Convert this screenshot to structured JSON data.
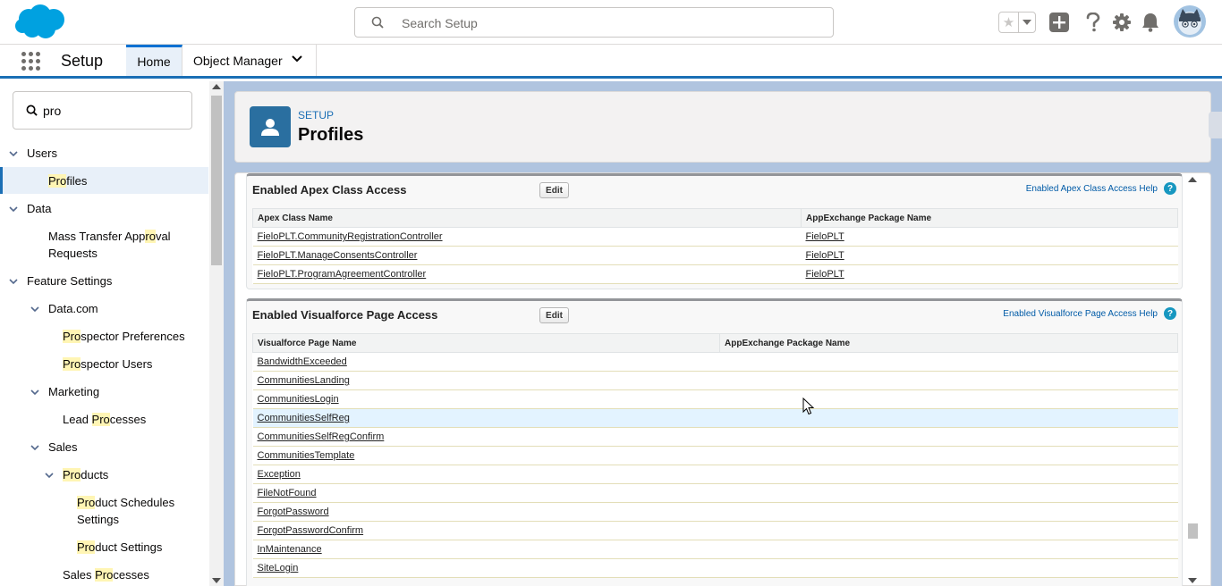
{
  "header": {
    "search_placeholder": "Search Setup",
    "icons": [
      "salesforce-cloud-logo",
      "favorites-star-icon",
      "add-icon",
      "help-icon",
      "setup-gear-icon",
      "notifications-bell-icon",
      "user-avatar"
    ],
    "brand_color": "#00a1e0"
  },
  "context": {
    "app_name": "Setup",
    "tabs": [
      {
        "label": "Home",
        "active": true
      },
      {
        "label": "Object Manager",
        "active": false
      }
    ]
  },
  "sidebar": {
    "quick_find_value": "pro",
    "highlight_color": "#fff5b4",
    "items": [
      {
        "pre": "",
        "hl": "",
        "post": "Users"
      },
      {
        "pre": "",
        "hl": "Pro",
        "post": "files"
      },
      {
        "pre": "",
        "hl": "",
        "post": "Data"
      },
      {
        "pre": "Mass Transfer App",
        "hl": "ro",
        "post": "val"
      },
      {
        "pre": "",
        "hl": "",
        "post": "Requests"
      },
      {
        "pre": "",
        "hl": "",
        "post": "Feature Settings"
      },
      {
        "pre": "",
        "hl": "",
        "post": "Data.com"
      },
      {
        "pre": "",
        "hl": "Pro",
        "post": "spector Preferences"
      },
      {
        "pre": "",
        "hl": "Pro",
        "post": "spector Users"
      },
      {
        "pre": "",
        "hl": "",
        "post": "Marketing"
      },
      {
        "pre": "Lead ",
        "hl": "Pro",
        "post": "cesses"
      },
      {
        "pre": "",
        "hl": "",
        "post": "Sales"
      },
      {
        "pre": "",
        "hl": "Pro",
        "post": "ducts"
      },
      {
        "pre": "",
        "hl": "Pro",
        "post": "duct Schedules"
      },
      {
        "pre": "",
        "hl": "",
        "post": "Settings"
      },
      {
        "pre": "",
        "hl": "Pro",
        "post": "duct Settings"
      },
      {
        "pre": "Sales ",
        "hl": "Pro",
        "post": "cesses"
      }
    ]
  },
  "page_header": {
    "breadcrumb": "SETUP",
    "title": "Profiles"
  },
  "apex_section": {
    "title": "Enabled Apex Class Access",
    "edit_label": "Edit",
    "help_label": "Enabled Apex Class Access Help",
    "help_glyph": "?",
    "columns": [
      "Apex Class Name",
      "AppExchange Package Name"
    ],
    "rows": [
      [
        "FieloPLT.CommunityRegistrationController",
        "FieloPLT"
      ],
      [
        "FieloPLT.ManageConsentsController",
        "FieloPLT"
      ],
      [
        "FieloPLT.ProgramAgreementController",
        "FieloPLT"
      ]
    ]
  },
  "vf_section": {
    "title": "Enabled Visualforce Page Access",
    "edit_label": "Edit",
    "help_label": "Enabled Visualforce Page Access Help",
    "help_glyph": "?",
    "columns": [
      "Visualforce Page Name",
      "AppExchange Package Name"
    ],
    "rows": [
      [
        "BandwidthExceeded",
        ""
      ],
      [
        "CommunitiesLanding",
        ""
      ],
      [
        "CommunitiesLogin",
        ""
      ],
      [
        "CommunitiesSelfReg",
        ""
      ],
      [
        "CommunitiesSelfRegConfirm",
        ""
      ],
      [
        "CommunitiesTemplate",
        ""
      ],
      [
        "Exception",
        ""
      ],
      [
        "FileNotFound",
        ""
      ],
      [
        "ForgotPassword",
        ""
      ],
      [
        "ForgotPasswordConfirm",
        ""
      ],
      [
        "InMaintenance",
        ""
      ],
      [
        "SiteLogin",
        ""
      ]
    ],
    "hovered_row": 3
  }
}
